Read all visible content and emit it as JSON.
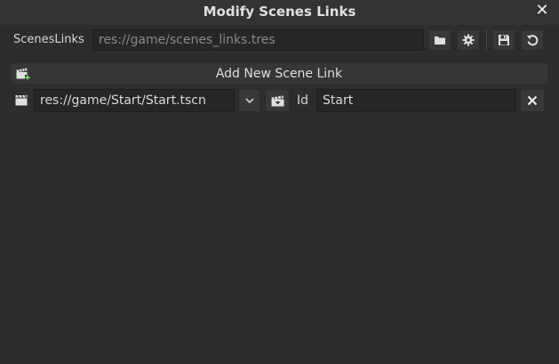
{
  "dialog": {
    "title": "Modify Scenes Links"
  },
  "resource_row": {
    "label": "ScenesLinks",
    "path_value": "res://game/scenes_links.tres"
  },
  "add_button": {
    "label": "Add New Scene Link"
  },
  "scene_links": [
    {
      "scene_path": "res://game/Start/Start.tscn",
      "id_label": "Id",
      "id_value": "Start"
    }
  ],
  "icons": {
    "close": "close-icon",
    "folder": "folder-icon",
    "settings": "gear-icon",
    "save": "save-icon",
    "reload": "reload-icon",
    "add_scene": "add-scene-icon",
    "scene": "clapperboard-icon",
    "dropdown": "chevron-down-icon",
    "instance": "instance-scene-icon",
    "remove": "remove-icon"
  },
  "colors": {
    "background": "#2d2d2d",
    "field": "#262626",
    "button": "#383838",
    "text": "#dcdcdc"
  }
}
